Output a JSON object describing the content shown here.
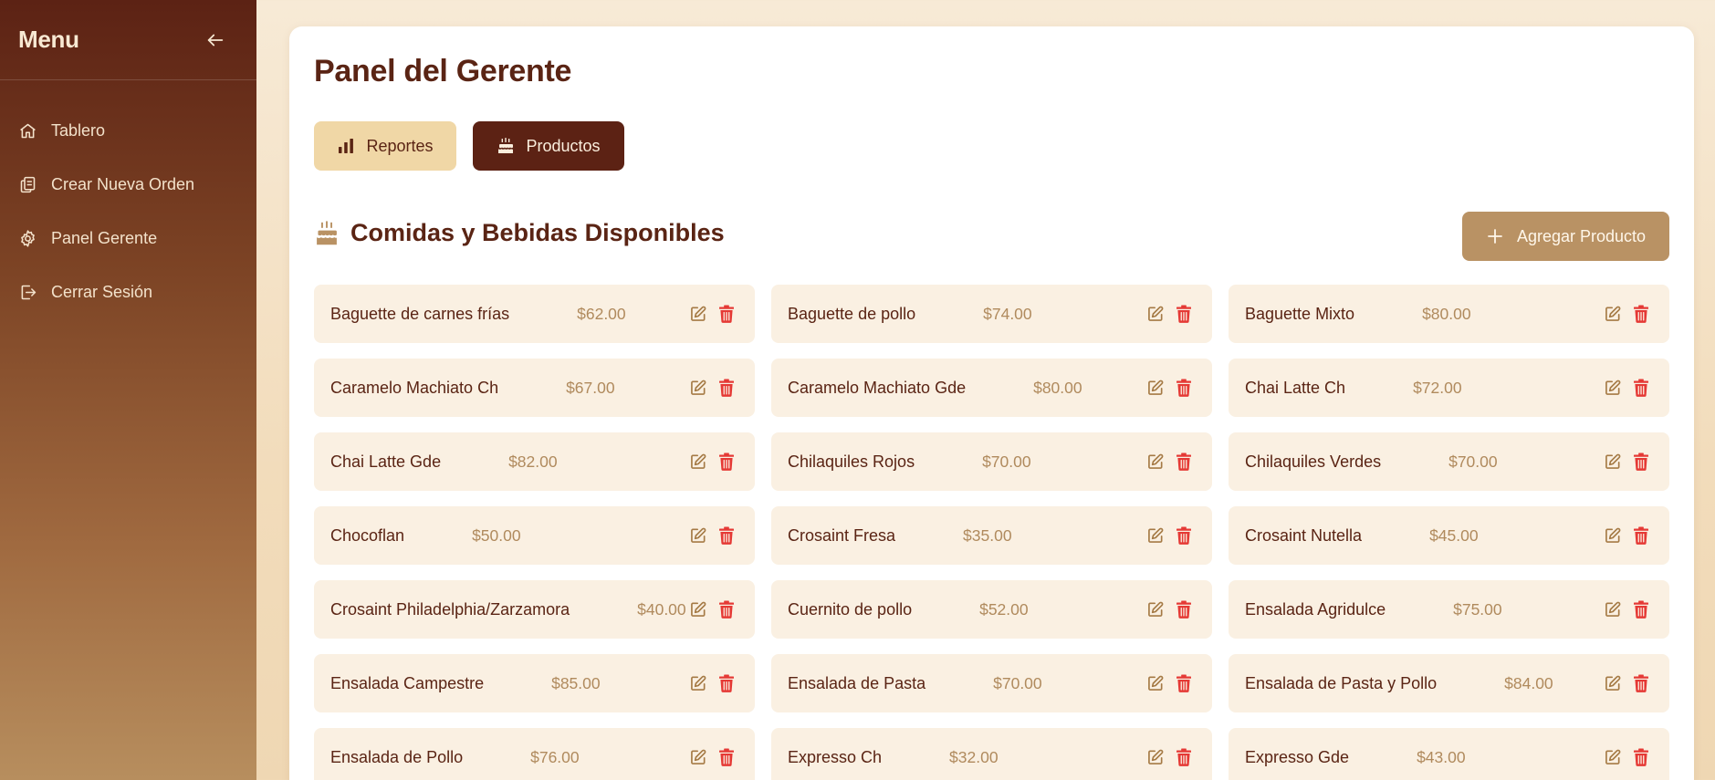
{
  "sidebar": {
    "title": "Menu",
    "items": [
      {
        "label": "Tablero",
        "icon": "home-icon"
      },
      {
        "label": "Crear Nueva Orden",
        "icon": "clipboard-copy-icon"
      },
      {
        "label": "Panel Gerente",
        "icon": "gear-icon"
      },
      {
        "label": "Cerrar Sesión",
        "icon": "logout-icon"
      }
    ]
  },
  "header": {
    "title": "Panel del Gerente"
  },
  "tabs": [
    {
      "label": "Reportes",
      "icon": "bar-chart-icon",
      "active": false
    },
    {
      "label": "Productos",
      "icon": "cake-icon",
      "active": true
    }
  ],
  "section": {
    "title": "Comidas y Bebidas Disponibles",
    "add_label": "Agregar Producto"
  },
  "products": [
    {
      "name": "Baguette de carnes frías",
      "price": "$62.00"
    },
    {
      "name": "Baguette de pollo",
      "price": "$74.00"
    },
    {
      "name": "Baguette Mixto",
      "price": "$80.00"
    },
    {
      "name": "Caramelo Machiato Ch",
      "price": "$67.00"
    },
    {
      "name": "Caramelo Machiato Gde",
      "price": "$80.00"
    },
    {
      "name": "Chai Latte Ch",
      "price": "$72.00"
    },
    {
      "name": "Chai Latte Gde",
      "price": "$82.00"
    },
    {
      "name": "Chilaquiles Rojos",
      "price": "$70.00"
    },
    {
      "name": "Chilaquiles Verdes",
      "price": "$70.00"
    },
    {
      "name": "Chocoflan",
      "price": "$50.00"
    },
    {
      "name": "Crosaint Fresa",
      "price": "$35.00"
    },
    {
      "name": "Crosaint Nutella",
      "price": "$45.00"
    },
    {
      "name": "Crosaint Philadelphia/Zarzamora",
      "price": "$40.00"
    },
    {
      "name": "Cuernito de pollo",
      "price": "$52.00"
    },
    {
      "name": "Ensalada Agridulce",
      "price": "$75.00"
    },
    {
      "name": "Ensalada Campestre",
      "price": "$85.00"
    },
    {
      "name": "Ensalada de Pasta",
      "price": "$70.00"
    },
    {
      "name": "Ensalada de Pasta y Pollo",
      "price": "$84.00"
    },
    {
      "name": "Ensalada de Pollo",
      "price": "$76.00"
    },
    {
      "name": "Expresso Ch",
      "price": "$32.00"
    },
    {
      "name": "Expresso Gde",
      "price": "$43.00"
    }
  ],
  "colors": {
    "brand_dark": "#5c2214",
    "accent": "#b99264",
    "card_bg": "#faf0e2",
    "delete": "#e53935",
    "edit": "#a57a45"
  }
}
